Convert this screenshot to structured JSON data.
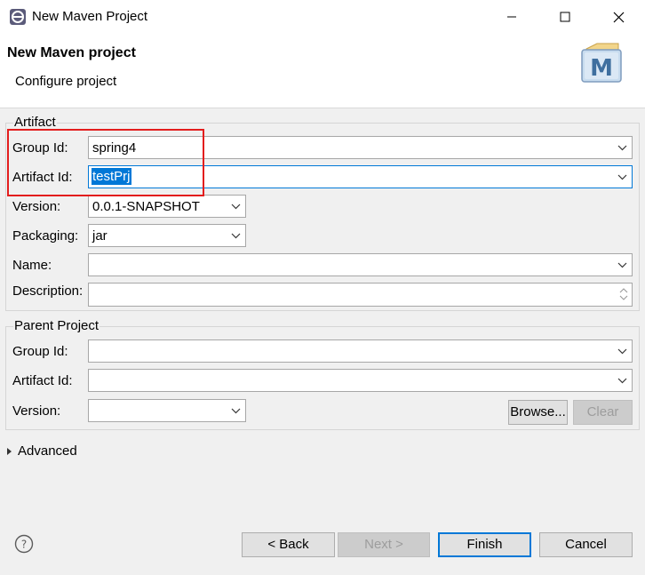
{
  "window": {
    "title": "New Maven Project",
    "app_icon": "eclipse-icon"
  },
  "header": {
    "title": "New Maven project",
    "subtitle": "Configure project",
    "logo_letter": "M"
  },
  "artifact": {
    "group_title": "Artifact",
    "group_id": {
      "label": "Group Id:",
      "value": "spring4"
    },
    "artifact_id": {
      "label": "Artifact Id:",
      "value": "testPrj"
    },
    "version": {
      "label": "Version:",
      "value": "0.0.1-SNAPSHOT"
    },
    "packaging": {
      "label": "Packaging:",
      "value": "jar"
    },
    "name": {
      "label": "Name:",
      "value": ""
    },
    "description": {
      "label": "Description:",
      "value": ""
    }
  },
  "parent": {
    "group_title": "Parent Project",
    "group_id": {
      "label": "Group Id:",
      "value": ""
    },
    "artifact_id": {
      "label": "Artifact Id:",
      "value": ""
    },
    "version": {
      "label": "Version:",
      "value": ""
    },
    "browse_label": "Browse...",
    "clear_label": "Clear"
  },
  "advanced_label": "Advanced",
  "footer": {
    "back_label": "< Back",
    "next_label": "Next >",
    "finish_label": "Finish",
    "cancel_label": "Cancel"
  },
  "colors": {
    "selection": "#0078d7",
    "annotation": "#e31d1d"
  }
}
